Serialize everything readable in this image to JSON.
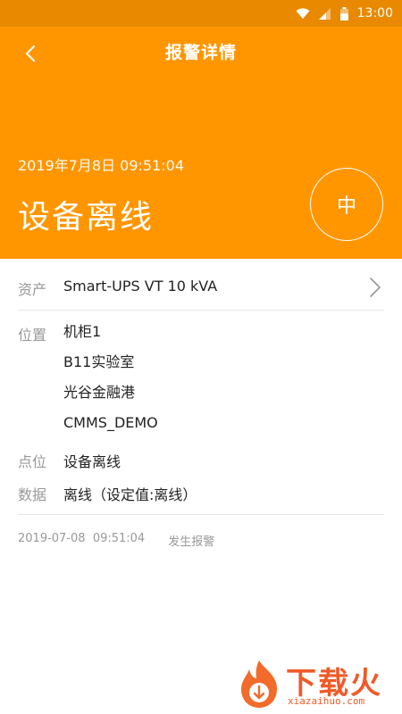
{
  "status_bar": {
    "time": "13:00"
  },
  "header": {
    "title": "报警详情",
    "datetime": "2019年7月8日 09:51:04",
    "alarm_name": "设备离线",
    "severity": "中",
    "background": "#ff9600"
  },
  "details": {
    "asset": {
      "label": "资产",
      "value": "Smart-UPS VT 10 kVA"
    },
    "location": {
      "label": "位置",
      "lines": [
        "机柜1",
        "B11实验室",
        "光谷金融港",
        "CMMS_DEMO"
      ]
    },
    "point": {
      "label": "点位",
      "value": "设备离线"
    },
    "data": {
      "label": "数据",
      "value": "离线（设定值:离线）"
    }
  },
  "footer": {
    "timestamp": "2019-07-08  09:51:04",
    "event": "发生报警"
  },
  "watermark": {
    "cn": "下载火",
    "en": "xiazaihuo.com"
  },
  "colors": {
    "accent": "#ff9600",
    "status_bar": "#e88900",
    "label": "#999999",
    "text": "#222222"
  }
}
